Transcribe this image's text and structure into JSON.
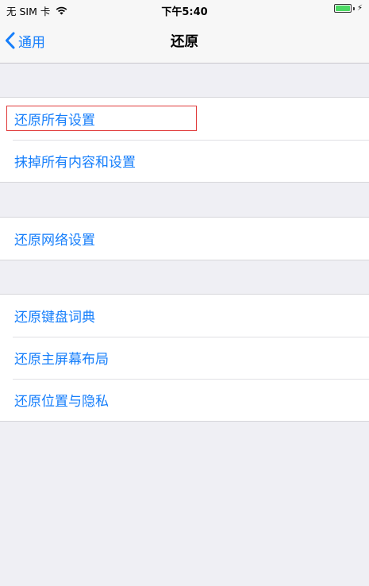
{
  "status_bar": {
    "carrier": "无 SIM 卡",
    "time": "下午5:40",
    "wifi_icon": "wifi-icon",
    "battery_icon": "battery-icon",
    "charging_icon": "charging-bolt-icon"
  },
  "nav": {
    "back_label": "通用",
    "title": "还原",
    "back_icon": "chevron-left-icon"
  },
  "groups": [
    {
      "items": [
        "还原所有设置",
        "抹掉所有内容和设置"
      ]
    },
    {
      "items": [
        "还原网络设置"
      ]
    },
    {
      "items": [
        "还原键盘词典",
        "还原主屏幕布局",
        "还原位置与隐私"
      ]
    }
  ],
  "colors": {
    "accent": "#157efb",
    "background": "#efeff4",
    "highlight": "#e03a3a",
    "battery": "#4cd964"
  }
}
